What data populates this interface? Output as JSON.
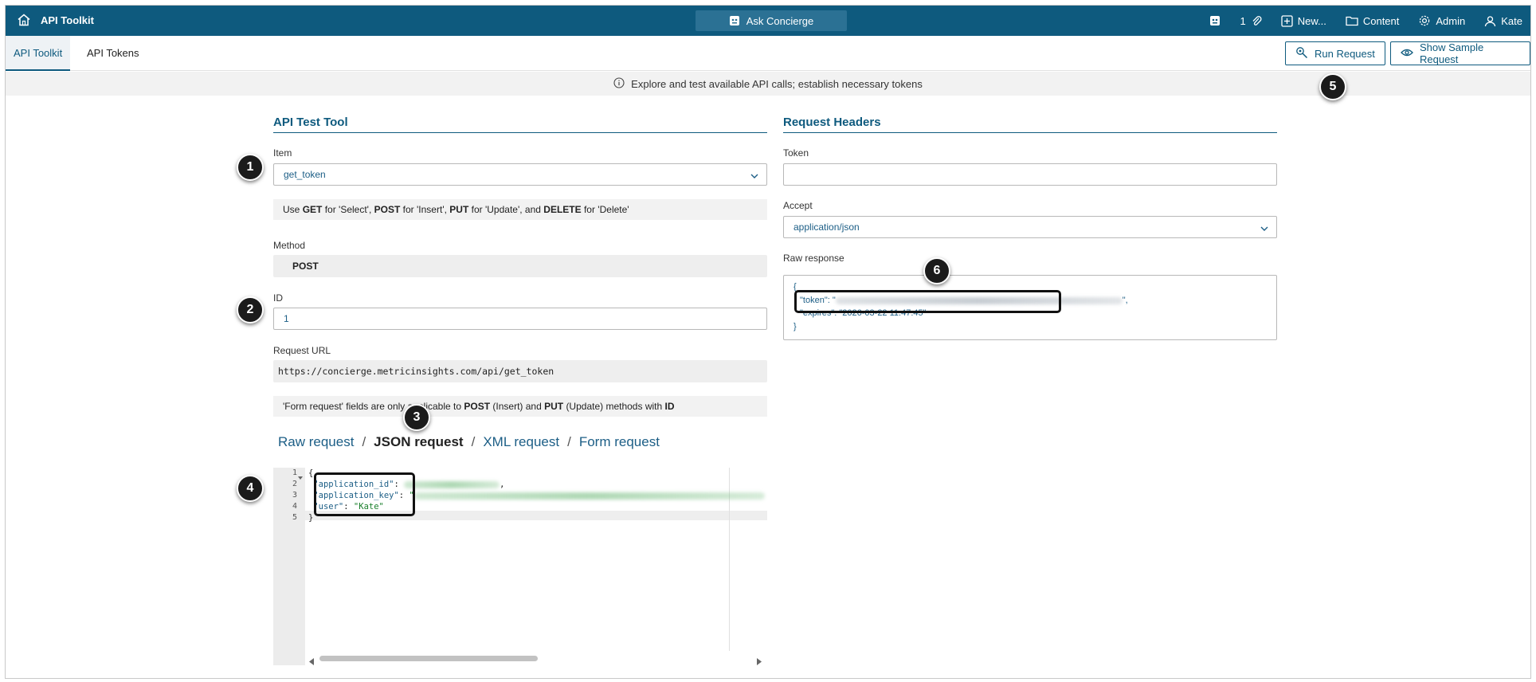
{
  "topbar": {
    "app_title": "API Toolkit",
    "concierge_label": "Ask Concierge",
    "count": "1",
    "new_label": "New...",
    "content_label": "Content",
    "admin_label": "Admin",
    "user_label": "Kate"
  },
  "tabs": [
    {
      "label": "API Toolkit",
      "active": true
    },
    {
      "label": "API Tokens",
      "active": false
    }
  ],
  "actions": {
    "run_label": "Run Request",
    "sample_label": "Show Sample Request"
  },
  "info": {
    "text": "Explore and test available API calls; establish necessary tokens"
  },
  "test_tool": {
    "title": "API Test Tool",
    "item_label": "Item",
    "item_value": "get_token",
    "method_hint": {
      "use": "Use",
      "get": "GET",
      "get_desc": "for 'Select',",
      "post": "POST",
      "post_desc": "for 'Insert',",
      "put": "PUT",
      "put_desc": "for 'Update', and",
      "delete": "DELETE",
      "delete_desc": "for 'Delete'"
    },
    "method_label": "Method",
    "method_value": "POST",
    "id_label": "ID",
    "id_value": "1",
    "url_label": "Request URL",
    "url_value": "https://concierge.metricinsights.com/api/get_token",
    "form_hint": {
      "lead": "'Form request' fields are only applicable to",
      "post": "POST",
      "mid": "(Insert) and",
      "put": "PUT",
      "tail": "(Update) methods with",
      "id": "ID"
    },
    "request_tabs": [
      "Raw request",
      "JSON request",
      "XML request",
      "Form request"
    ],
    "request_tab_separator": "/",
    "active_request_tab": "JSON request",
    "code": {
      "line_numbers": [
        "1",
        "2",
        "3",
        "4",
        "5"
      ],
      "open": "{",
      "close": "}",
      "app_id_key": "\"application_id\"",
      "app_key_key": "\"application_key\"",
      "user_key": "\"user\"",
      "user_value": "\"Kate\"",
      "colon": ":",
      "comma": ",",
      "quote": "\""
    }
  },
  "headers": {
    "title": "Request Headers",
    "token_label": "Token",
    "token_value": "",
    "accept_label": "Accept",
    "accept_value": "application/json",
    "raw_label": "Raw response",
    "raw": {
      "open": "{",
      "token_key": "\"token\": \"",
      "token_end": "\",",
      "expires_line": "\"expires\": \"2026-03-22 11:47:45\"",
      "close": "}"
    }
  },
  "callouts": [
    "1",
    "2",
    "3",
    "4",
    "5",
    "6"
  ]
}
